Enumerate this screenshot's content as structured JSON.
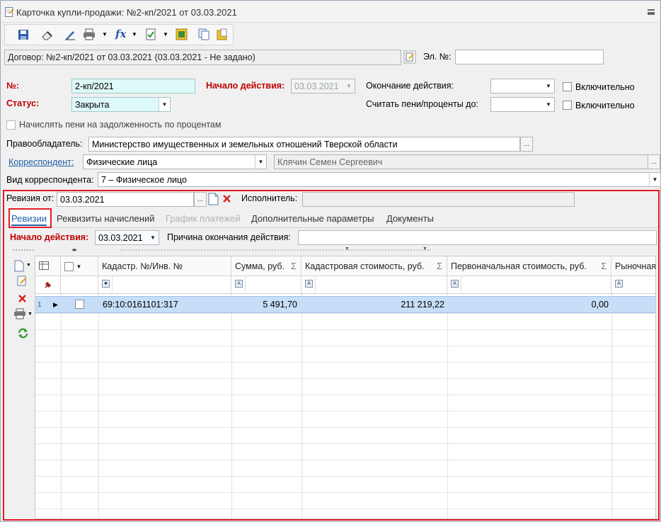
{
  "window": {
    "title": "Карточка купли-продажи: №2-кп/2021 от 03.03.2021"
  },
  "header": {
    "contract_text": "Договор: №2-кп/2021 от 03.03.2021 (03.03.2021 -  Не задано)",
    "el_no_label": "Эл. №:",
    "el_no_value": ""
  },
  "form": {
    "number_label": "№:",
    "number_value": "2-кп/2021",
    "start_label": "Начало действия:",
    "start_value": "03.03.2021",
    "end_label": "Окончание действия:",
    "end_value": "",
    "inclusive_label_1": "Включительно",
    "status_label": "Статус:",
    "status_value": "Закрыта",
    "penalty_until_label": "Считать пени/проценты до:",
    "penalty_until_value": "",
    "inclusive_label_2": "Включительно",
    "accrue_penalty_label": "Начислять пени на задолженность по процентам",
    "owner_label": "Правообладатель:",
    "owner_value": "Министерство имущественных и земельных отношений Тверской области",
    "correspondent_label": "Корреспондент:",
    "correspondent_type": "Физические лица",
    "correspondent_name": "Клячин Семен Сергеевич",
    "corr_kind_label": "Вид корреспондента:",
    "corr_kind_value": "7 – Физическое лицо",
    "ellipsis": "..."
  },
  "revision": {
    "from_label": "Ревизия от:",
    "from_value": "03.03.2021",
    "executor_label": "Исполнитель:",
    "executor_value": "",
    "tabs": [
      {
        "label": "Ревизии"
      },
      {
        "label": "Реквизиты начислений"
      },
      {
        "label": "График платежей"
      },
      {
        "label": "Дополнительные параметры"
      },
      {
        "label": "Документы"
      }
    ],
    "start_label": "Начало действия:",
    "start_value": "03.03.2021",
    "end_reason_label": "Причина окончания действия:",
    "end_reason_value": ""
  },
  "grid": {
    "columns": [
      {
        "label": "Кадастр. №/Инв. №"
      },
      {
        "label": "Сумма, руб."
      },
      {
        "label": "Кадастровая стоимость, руб."
      },
      {
        "label": "Первоначальная стоимость, руб."
      },
      {
        "label": "Рыночная"
      }
    ],
    "sigma": "Σ",
    "rows": [
      {
        "num": "1",
        "cadastral": "69:10:0161101:317",
        "sum": "5 491,70",
        "cad_cost": "211 219,22",
        "initial_cost": "0,00",
        "market": ""
      }
    ]
  },
  "colors": {
    "accent_red": "#c00000",
    "highlight_frame": "#e31b23",
    "selected_row": "#c6def7",
    "required_field": "#ddfaf8"
  }
}
